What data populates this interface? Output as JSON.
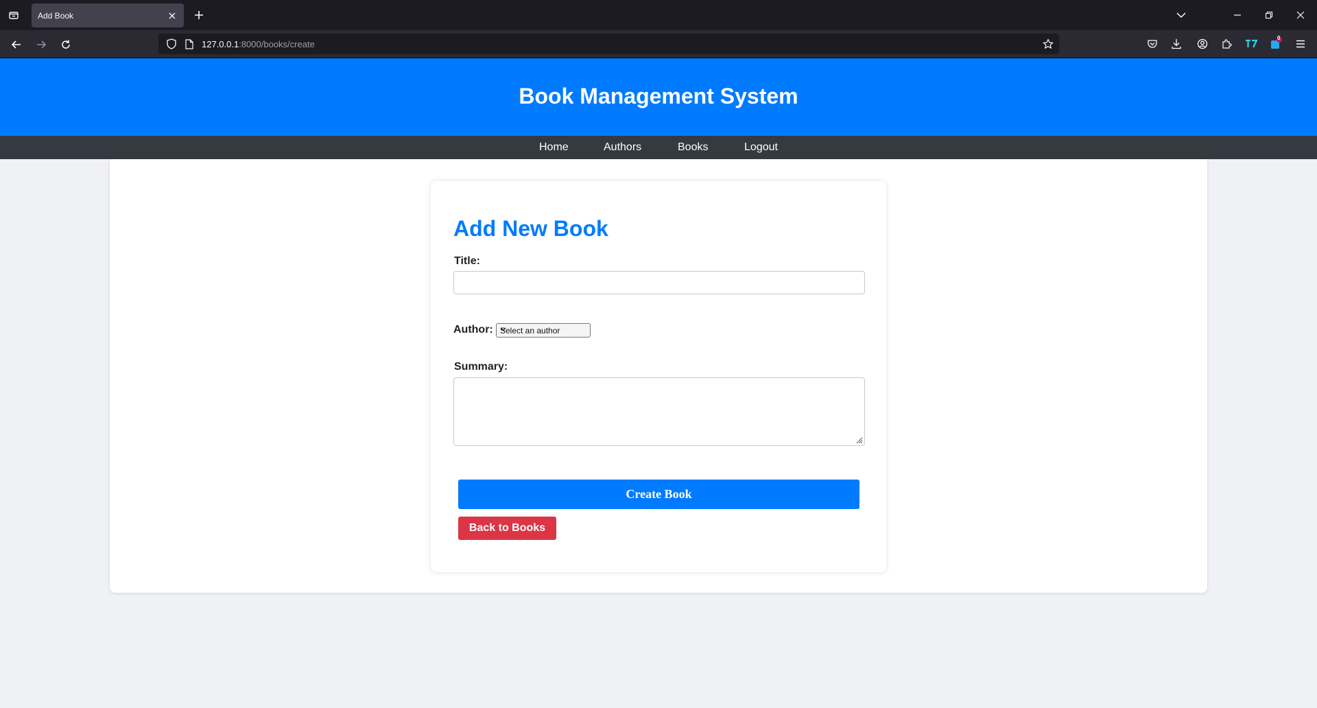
{
  "browser": {
    "tab_title": "Add Book",
    "url_host": "127.0.0.1",
    "url_path": ":8000/books/create",
    "badge_count": "0"
  },
  "header": {
    "title": "Book Management System"
  },
  "nav": {
    "items": [
      {
        "label": "Home"
      },
      {
        "label": "Authors"
      },
      {
        "label": "Books"
      },
      {
        "label": "Logout"
      }
    ]
  },
  "form": {
    "heading": "Add New Book",
    "title_label": "Title:",
    "title_value": "",
    "author_label": "Author:",
    "author_selected": "Select an author",
    "summary_label": "Summary:",
    "summary_value": "",
    "submit_label": "Create Book",
    "back_label": "Back to Books"
  },
  "colors": {
    "primary": "#007bff",
    "nav_bg": "#343a40",
    "danger": "#dc3545",
    "page_bg": "#f0f1f5"
  }
}
